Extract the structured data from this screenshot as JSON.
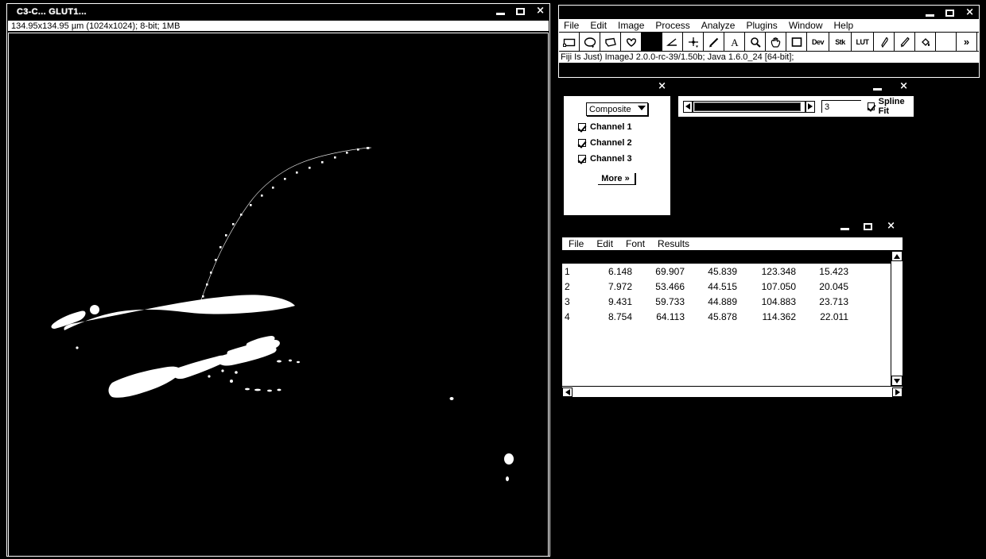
{
  "image_window": {
    "title": "C3-C... GLUT1...",
    "info_line": "134.95x134.95 µm (1024x1024); 8-bit; 1MB",
    "buttons": {
      "minimize": "–",
      "maximize": "□",
      "close": "×"
    }
  },
  "fiji_main": {
    "title": "",
    "menus": [
      "File",
      "Edit",
      "Image",
      "Process",
      "Analyze",
      "Plugins",
      "Window",
      "Help"
    ],
    "tools": [
      {
        "name": "rectangle-tool",
        "label": ""
      },
      {
        "name": "oval-tool",
        "label": ""
      },
      {
        "name": "polygon-tool",
        "label": ""
      },
      {
        "name": "freehand-tool",
        "label": ""
      },
      {
        "name": "line-tool",
        "label": "",
        "selected": true
      },
      {
        "name": "angle-tool",
        "label": ""
      },
      {
        "name": "point-tool",
        "label": ""
      },
      {
        "name": "wand-tool",
        "label": ""
      },
      {
        "name": "text-tool",
        "label": "A"
      },
      {
        "name": "magnifier-tool",
        "label": ""
      },
      {
        "name": "hand-tool",
        "label": ""
      },
      {
        "name": "dropper-tool",
        "label": ""
      },
      {
        "name": "dev-tool",
        "label": "Dev"
      },
      {
        "name": "stk-tool",
        "label": "Stk"
      },
      {
        "name": "lut-tool",
        "label": "LUT"
      },
      {
        "name": "pencil-tool",
        "label": ""
      },
      {
        "name": "brush-tool",
        "label": ""
      },
      {
        "name": "flood-fill-tool",
        "label": ""
      },
      {
        "name": "spare-tool",
        "label": ""
      },
      {
        "name": "more-tools",
        "label": "»"
      }
    ],
    "status": "Fiji Is Just) ImageJ 2.0.0-rc-39/1.50b; Java 1.6.0_24 [64-bit];",
    "buttons": {
      "minimize": "–",
      "maximize": "□",
      "close": "×"
    }
  },
  "channels_window": {
    "title": "",
    "mode": "Composite",
    "channels": [
      {
        "label": "Channel 1",
        "checked": true
      },
      {
        "label": "Channel 2",
        "checked": true
      },
      {
        "label": "Channel 3",
        "checked": true
      }
    ],
    "more_label": "More »",
    "close_label": "×"
  },
  "spline_window": {
    "title": "",
    "scroll_value": "",
    "width_value": "3",
    "spline_fit_label": "Spline Fit",
    "spline_fit_checked": true,
    "buttons": {
      "minimize": "–",
      "close": "×"
    }
  },
  "results_window": {
    "title": "",
    "menus": [
      "File",
      "Edit",
      "Font",
      "Results"
    ],
    "columns": [
      "",
      "",
      "",
      "",
      "",
      ""
    ],
    "rows": [
      [
        "1",
        "6.148",
        "69.907",
        "45.839",
        "123.348",
        "15.423"
      ],
      [
        "2",
        "7.972",
        "53.466",
        "44.515",
        "107.050",
        "20.045"
      ],
      [
        "3",
        "9.431",
        "59.733",
        "44.889",
        "104.883",
        "23.713"
      ],
      [
        "4",
        "8.754",
        "64.113",
        "45.878",
        "114.362",
        "22.011"
      ]
    ],
    "buttons": {
      "minimize": "–",
      "maximize": "□",
      "close": "×"
    }
  },
  "colors": {
    "background": "#000000",
    "window_face": "#ffffff",
    "text": "#000000",
    "title_text": "#ffffff"
  }
}
